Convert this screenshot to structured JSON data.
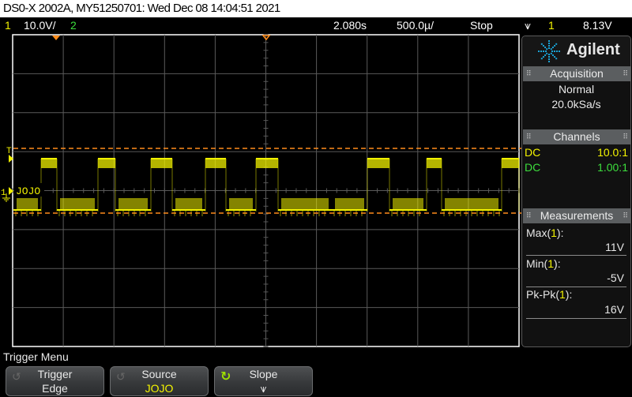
{
  "title_bar": {
    "text": "DS0-X 2002A, MY51250701: Wed Dec 08 14:04:51 2021"
  },
  "status_bar": {
    "ch1_label": "1",
    "ch1_scale": "10.0V/",
    "ch2_label": "2",
    "time_delay": "2.080s",
    "time_scale": "500.0µ/",
    "run_state": "Stop",
    "trigger_slope_symbol": "⩛",
    "trigger_source": "1",
    "trigger_level": "8.13V"
  },
  "scope": {
    "channel1_marker": "1",
    "trigger_marker": "T",
    "channel1_label": "JOJO",
    "colors": {
      "channel1": "#f0f000",
      "channel2": "#3ddf3d",
      "trigger": "#ff8c1a",
      "grid": "#5a5a5a"
    }
  },
  "side_panel": {
    "brand": "Agilent",
    "acquisition": {
      "title": "Acquisition",
      "mode": "Normal",
      "sample_rate": "20.0kSa/s"
    },
    "channels": {
      "title": "Channels",
      "rows": [
        {
          "coupling": "DC",
          "probe": "10.0:1",
          "color": "#f4f400"
        },
        {
          "coupling": "DC",
          "probe": "1.00:1",
          "color": "#3ddf3d"
        }
      ]
    },
    "measurements": {
      "title": "Measurements",
      "items": [
        {
          "name": "Max(",
          "channel": "1",
          "close": "):",
          "value": "11V"
        },
        {
          "name": "Min(",
          "channel": "1",
          "close": "):",
          "value": "-5V"
        },
        {
          "name": "Pk-Pk(",
          "channel": "1",
          "close": "):",
          "value": "16V"
        }
      ]
    }
  },
  "trigger_menu": {
    "title": "Trigger Menu",
    "softkeys": [
      {
        "label": "Trigger",
        "value": "Edge"
      },
      {
        "label": "Source",
        "value": "JOJO"
      },
      {
        "label": "Slope",
        "value": "⩛"
      }
    ]
  }
}
